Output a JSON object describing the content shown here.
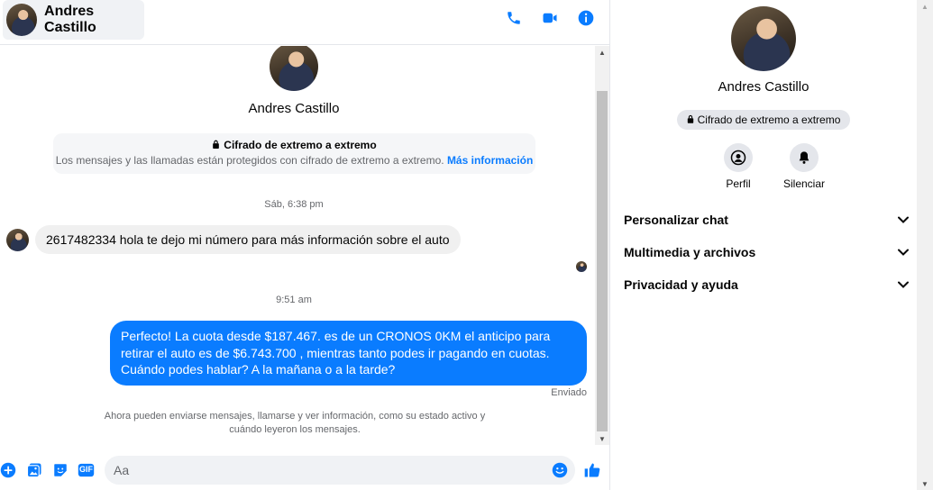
{
  "contact": {
    "name": "Andres Castillo"
  },
  "header": {
    "call_icon": "phone-icon",
    "video_icon": "video-camera-icon",
    "info_icon": "info-icon"
  },
  "encryption": {
    "title": "Cifrado de extremo a extremo",
    "text": "Los mensajes y las llamadas están protegidos con cifrado de extremo a extremo.",
    "link": "Más información"
  },
  "messages": {
    "time1": "Sáb, 6:38 pm",
    "incoming1": "2617482334 hola te dejo mi número para más información sobre el auto",
    "time2": "9:51 am",
    "outgoing1": "Perfecto! La cuota desde $187.467. es de un CRONOS 0KM el anticipo para retirar el auto es de $6.743.700 , mientras tanto podes ir pagando en cuotas. Cuándo podes hablar? A la mañana o a la tarde?",
    "sent_status": "Enviado",
    "notice": "Ahora pueden enviarse mensajes, llamarse y ver información, como su estado activo y cuándo leyeron los mensajes."
  },
  "composer": {
    "placeholder": "Aa",
    "icons": [
      "plus-icon",
      "image-icon",
      "sticker-icon",
      "gif-icon",
      "emoji-icon",
      "thumbs-up-icon"
    ],
    "gif_label": "GIF"
  },
  "info_panel": {
    "name": "Andres Castillo",
    "badge": "Cifrado de extremo a extremo",
    "actions": [
      {
        "label": "Perfil",
        "icon": "profile-icon"
      },
      {
        "label": "Silenciar",
        "icon": "bell-icon"
      }
    ],
    "sections": [
      {
        "title": "Personalizar chat"
      },
      {
        "title": "Multimedia y archivos"
      },
      {
        "title": "Privacidad y ayuda"
      }
    ]
  },
  "colors": {
    "accent": "#0a7cff",
    "outgoing_bubble": "#0a7cff",
    "incoming_bubble": "#f0f0f0",
    "muted_text": "#65676b"
  }
}
